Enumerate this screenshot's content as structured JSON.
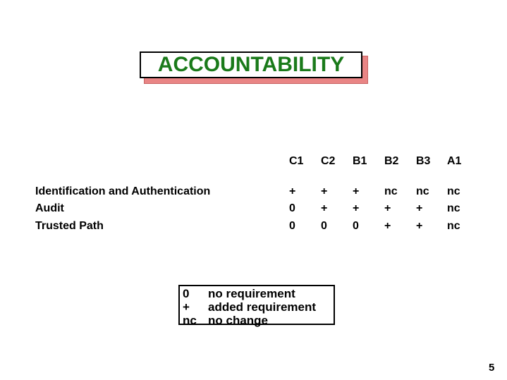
{
  "title": "ACCOUNTABILITY",
  "colors": {
    "title_text": "#1a7a1a",
    "title_shadow": "#e98585"
  },
  "table": {
    "columns": [
      "C1",
      "C2",
      "B1",
      "B2",
      "B3",
      "A1"
    ],
    "rows": [
      {
        "label": "Identification and Authentication",
        "values": [
          "+",
          "+",
          "+",
          "nc",
          "nc",
          "nc"
        ]
      },
      {
        "label": "Audit",
        "values": [
          "0",
          "+",
          "+",
          "+",
          "+",
          "nc"
        ]
      },
      {
        "label": "Trusted Path",
        "values": [
          "0",
          "0",
          "0",
          "+",
          "+",
          "nc"
        ]
      }
    ]
  },
  "legend": [
    {
      "symbol": "0",
      "meaning": "no requirement"
    },
    {
      "symbol": "+",
      "meaning": "added requirement"
    },
    {
      "symbol": "nc",
      "meaning": "no change"
    }
  ],
  "page_number": "5"
}
